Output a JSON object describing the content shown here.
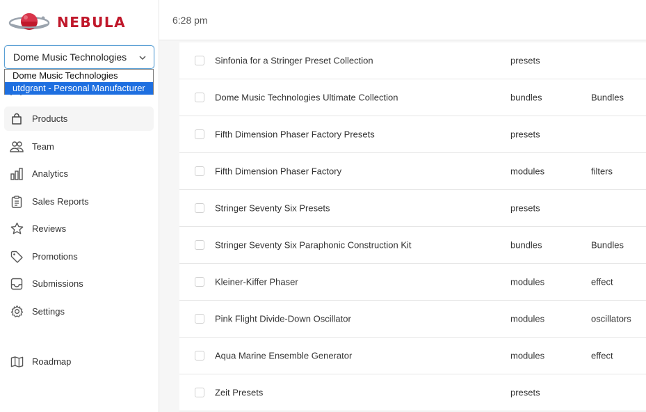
{
  "brand": {
    "name": "NEBULA",
    "logo_icon": "planet-logo-icon",
    "color": "#c0182b"
  },
  "org_select": {
    "value": "Dome Music Technologies",
    "options": [
      "Dome Music Technologies",
      "utdgrant - Personal Manufacturer"
    ],
    "highlighted_index": 1
  },
  "nav": [
    {
      "label": "Products",
      "icon": "bag-icon",
      "active": true
    },
    {
      "label": "Team",
      "icon": "users-icon"
    },
    {
      "label": "Analytics",
      "icon": "bar-chart-icon"
    },
    {
      "label": "Sales Reports",
      "icon": "clipboard-icon"
    },
    {
      "label": "Reviews",
      "icon": "star-icon"
    },
    {
      "label": "Promotions",
      "icon": "tag-icon"
    },
    {
      "label": "Submissions",
      "icon": "inbox-icon"
    },
    {
      "label": "Settings",
      "icon": "gear-icon"
    },
    {
      "label": "Roadmap",
      "icon": "map-icon"
    }
  ],
  "header": {
    "time": "6:28 pm"
  },
  "products": [
    {
      "name": "Sinfonia for a Stringer Preset Collection",
      "type": "presets",
      "category": ""
    },
    {
      "name": "Dome Music Technologies Ultimate Collection",
      "type": "bundles",
      "category": "Bundles"
    },
    {
      "name": "Fifth Dimension Phaser Factory Presets",
      "type": "presets",
      "category": ""
    },
    {
      "name": "Fifth Dimension Phaser Factory",
      "type": "modules",
      "category": "filters"
    },
    {
      "name": "Stringer Seventy Six Presets",
      "type": "presets",
      "category": ""
    },
    {
      "name": "Stringer Seventy Six Paraphonic Construction Kit",
      "type": "bundles",
      "category": "Bundles"
    },
    {
      "name": "Kleiner-Kiffer Phaser",
      "type": "modules",
      "category": "effect"
    },
    {
      "name": "Pink Flight Divide-Down Oscillator",
      "type": "modules",
      "category": "oscillators"
    },
    {
      "name": "Aqua Marine Ensemble Generator",
      "type": "modules",
      "category": "effect"
    },
    {
      "name": "Zeit Presets",
      "type": "presets",
      "category": ""
    }
  ]
}
